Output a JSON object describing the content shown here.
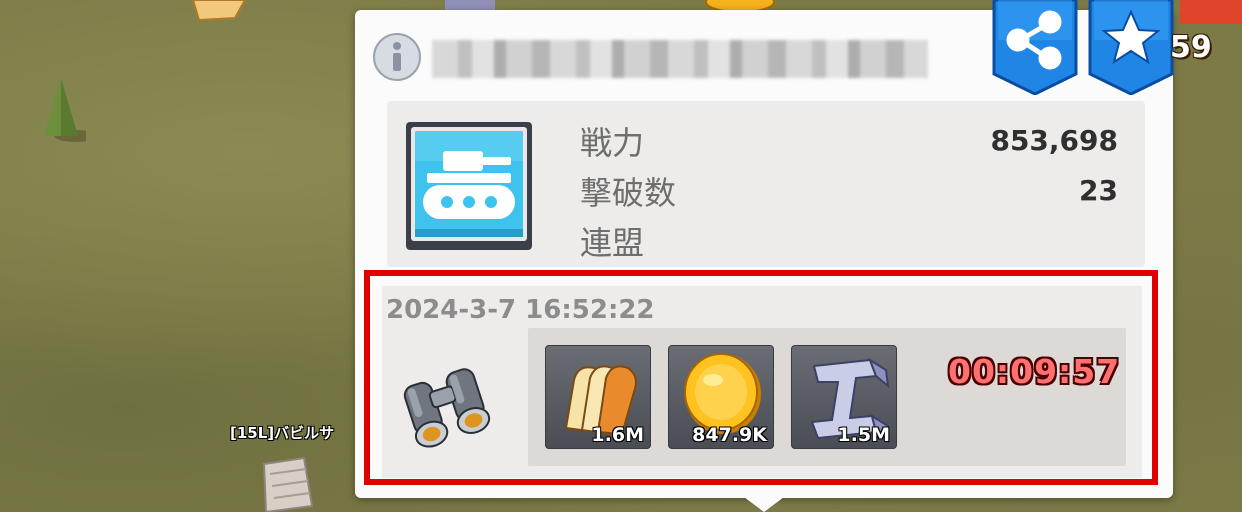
{
  "map": {
    "player_label": "[15L]バビルサ"
  },
  "header": {
    "corner_number": "59",
    "share_icon": "share-icon",
    "favorite_icon": "star-icon",
    "info_icon": "info-icon"
  },
  "stats": {
    "unit_icon": "tank-icon",
    "rows": [
      {
        "label": "戦力",
        "value": "853,698"
      },
      {
        "label": "撃破数",
        "value": "23"
      },
      {
        "label": "連盟",
        "value": ""
      }
    ]
  },
  "report": {
    "timestamp": "2024-3-7 16:52:22",
    "scout_icon": "binoculars-icon",
    "resources": [
      {
        "icon": "bread-icon",
        "amount": "1.6M"
      },
      {
        "icon": "coin-icon",
        "amount": "847.9K"
      },
      {
        "icon": "iron-icon",
        "amount": "1.5M"
      }
    ],
    "timer": "00:09:57",
    "highlight_color": "#e00000"
  }
}
